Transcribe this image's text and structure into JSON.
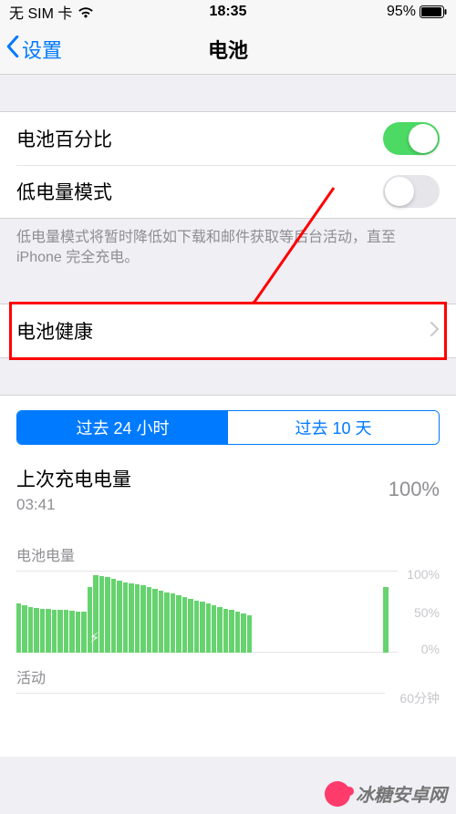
{
  "status": {
    "carrier": "无 SIM 卡",
    "time": "18:35",
    "battery_pct": "95%"
  },
  "nav": {
    "back": "设置",
    "title": "电池"
  },
  "cells": {
    "battery_percentage": "电池百分比",
    "low_power_mode": "低电量模式",
    "battery_health": "电池健康"
  },
  "switch_state": {
    "battery_percentage_on": true,
    "low_power_mode_on": false
  },
  "footer": "低电量模式将暂时降低如下载和邮件获取等后台活动，直至 iPhone 完全充电。",
  "segmented": {
    "last_24h": "过去 24 小时",
    "last_10d": "过去 10 天",
    "active": "last_24h"
  },
  "last_charge": {
    "title": "上次充电电量",
    "time": "03:41",
    "value": "100%"
  },
  "chart_labels": {
    "battery_level": "电池电量",
    "activity": "活动",
    "y100": "100%",
    "y50": "50%",
    "y0": "0%",
    "m60": "60分钟"
  },
  "chart_data": {
    "type": "bar",
    "title": "电池电量",
    "xlabel": "",
    "ylabel": "%",
    "ylim": [
      0,
      100
    ],
    "categories_note": "hourly bars over past 24h (approx)",
    "values": [
      60,
      58,
      56,
      55,
      54,
      54,
      53,
      52,
      52,
      51,
      50,
      50,
      80,
      95,
      94,
      92,
      90,
      88,
      86,
      85,
      84,
      82,
      80,
      78,
      76,
      74,
      72,
      70,
      68,
      66,
      64,
      62,
      60,
      58,
      56,
      54,
      52,
      50,
      48,
      46,
      0,
      0,
      0,
      0,
      0,
      0,
      0,
      0,
      0,
      0,
      0,
      0,
      0,
      0,
      0,
      0,
      0,
      0,
      0,
      0,
      0,
      0,
      80,
      0
    ]
  },
  "watermark": "冰糖安卓网"
}
